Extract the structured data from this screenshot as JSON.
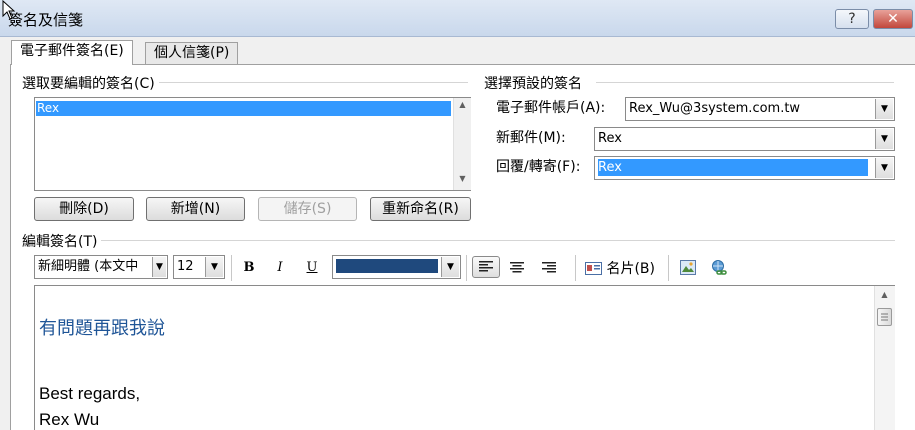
{
  "window": {
    "title": "簽名及信箋",
    "help_label": "?",
    "close_label": "✕"
  },
  "tabs": [
    {
      "label": "電子郵件簽名(E)",
      "selected": true
    },
    {
      "label": "個人信箋(P)",
      "selected": false
    }
  ],
  "select_signature": {
    "label": "選取要編輯的簽名(C)",
    "items": [
      "Rex"
    ],
    "selected": "Rex"
  },
  "buttons": {
    "delete": "刪除(D)",
    "new": "新增(N)",
    "save": "儲存(S)",
    "rename": "重新命名(R)"
  },
  "default_signature": {
    "label": "選擇預設的簽名",
    "account_label": "電子郵件帳戶(A):",
    "account_value": "Rex_Wu@3system.com.tw",
    "new_messages_label": "新郵件(M):",
    "new_messages_value": "Rex",
    "reply_forward_label": "回覆/轉寄(F):",
    "reply_forward_value": "Rex"
  },
  "edit_signature": {
    "label": "編輯簽名(T)",
    "font_name": "新細明體 (本文中",
    "font_size": "12",
    "font_color": "#1f497d",
    "bold_label": "B",
    "italic_label": "I",
    "underline_label": "U",
    "business_card_label": "名片(B)",
    "content_lines": [
      "有問題再跟我說",
      "Best regards,",
      "Rex Wu"
    ]
  },
  "colors": {
    "selection": "#3399ff",
    "signature_text": "#1f5597"
  }
}
